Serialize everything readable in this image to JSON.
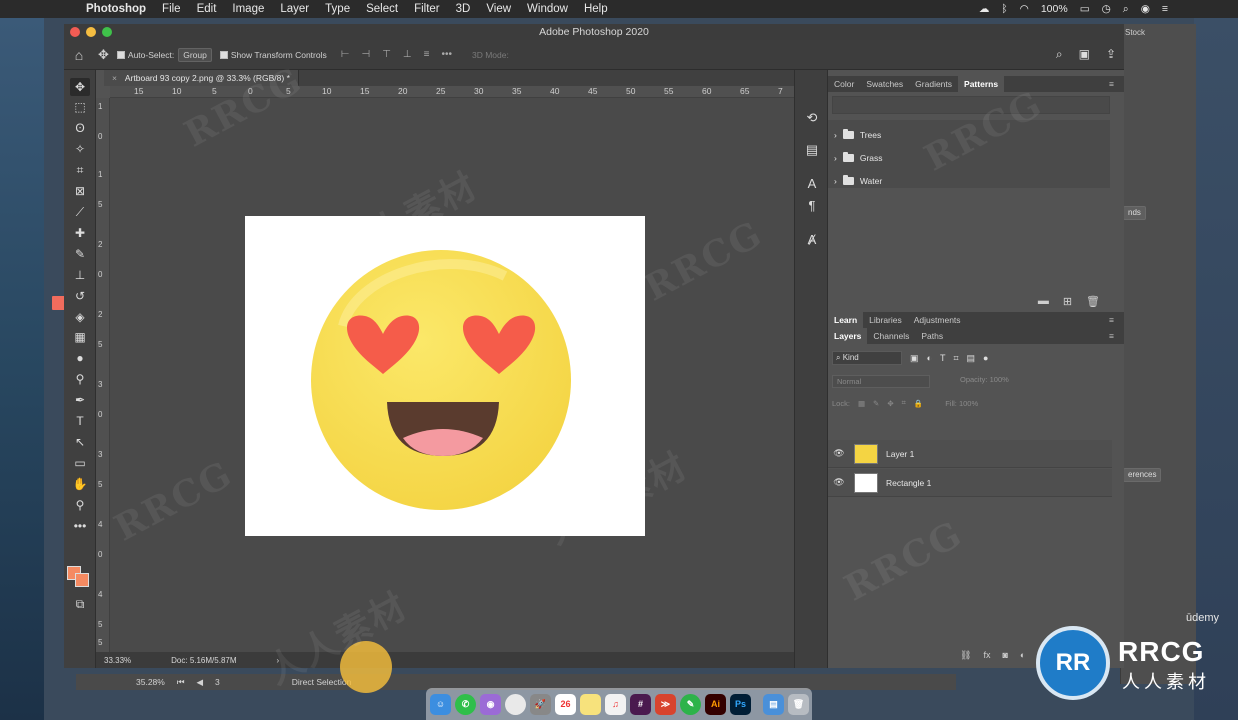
{
  "menubar": {
    "apple": "",
    "items": [
      "Photoshop",
      "File",
      "Edit",
      "Image",
      "Layer",
      "Type",
      "Select",
      "Filter",
      "3D",
      "View",
      "Window",
      "Help"
    ],
    "battery": "100%"
  },
  "window": {
    "title": "Adobe Photoshop 2020"
  },
  "options_bar": {
    "auto_select_label": "Auto-Select:",
    "auto_select_value": "Group",
    "show_transform_label": "Show Transform Controls",
    "mode_3d": "3D Mode:"
  },
  "document_tab": {
    "title": "Artboard 93 copy 2.png @ 33.3% (RGB/8) *"
  },
  "ruler_h": [
    "15",
    "10",
    "5",
    "0",
    "5",
    "10",
    "15",
    "20",
    "25",
    "30",
    "35",
    "40",
    "45",
    "50",
    "55",
    "60",
    "65",
    "7"
  ],
  "ruler_v": [
    "1",
    "0",
    "1",
    "5",
    "2",
    "0",
    "2",
    "5",
    "3",
    "0",
    "3",
    "5",
    "4",
    "0",
    "4",
    "5",
    "5"
  ],
  "status": {
    "zoom": "33.33%",
    "doc": "Doc: 5.16M/5.87M"
  },
  "patterns_panel": {
    "tabs": [
      "Color",
      "Swatches",
      "Gradients",
      "Patterns"
    ],
    "active_tab": "Patterns",
    "items": [
      "Trees",
      "Grass",
      "Water"
    ]
  },
  "learn_tabs": [
    "Learn",
    "Libraries",
    "Adjustments"
  ],
  "layers_panel": {
    "tabs": [
      "Layers",
      "Channels",
      "Paths"
    ],
    "kind": "Kind",
    "blend_mode": "Normal",
    "opacity_label": "Opacity:",
    "opacity_value": "100%",
    "lock_label": "Lock:",
    "fill_label": "Fill:",
    "fill_value": "100%",
    "layers": [
      {
        "name": "Layer 1"
      },
      {
        "name": "Rectangle 1"
      }
    ]
  },
  "bottom_bar": {
    "zoom": "35.28%",
    "page": "3",
    "selection": "Direct Selection"
  },
  "back_window": {
    "stock": "Stock",
    "nds": "nds",
    "erences": "erences"
  },
  "branding": {
    "udemy": "ūdemy",
    "rrcg": "RRCG",
    "rrcg_sub": "人人素材",
    "watermark": "RRCG",
    "watermark_cn": "人人素材"
  },
  "colors": {
    "foreground": "#f58a61",
    "emoji_face": "#f9dc4f",
    "hearts": "#f55c4a"
  }
}
